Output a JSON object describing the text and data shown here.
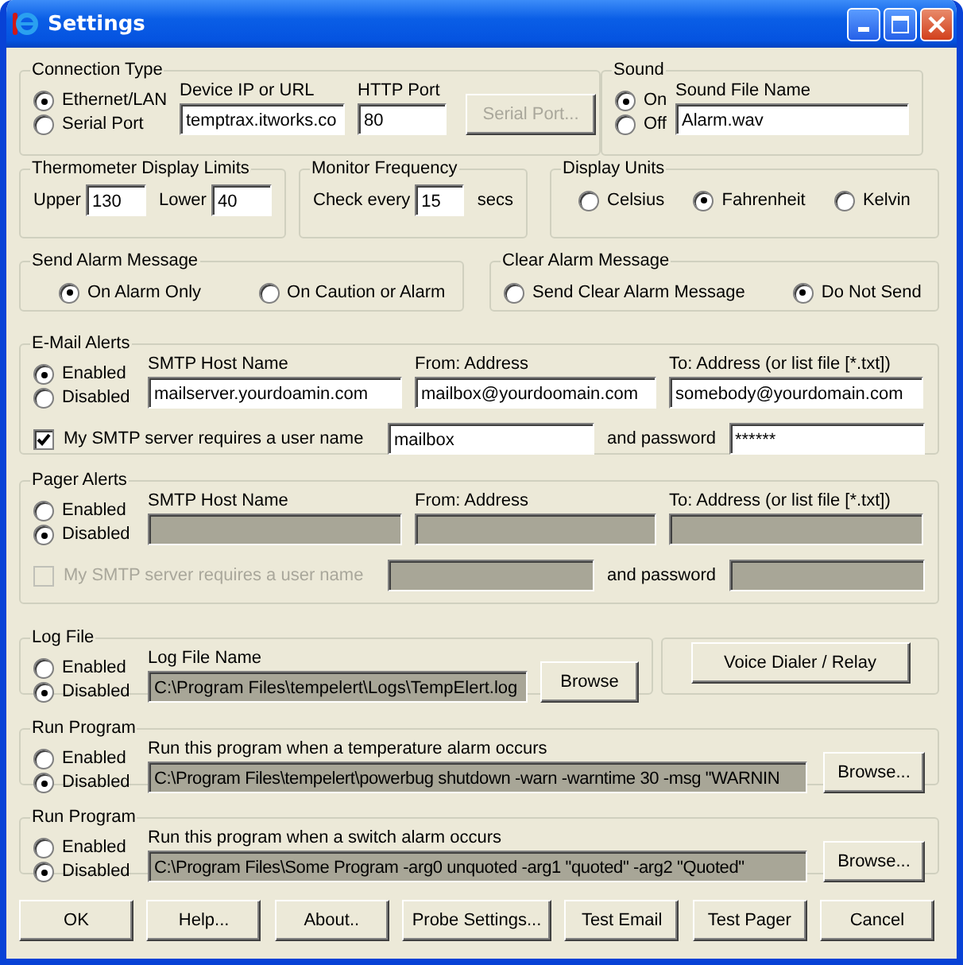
{
  "window": {
    "title": "Settings"
  },
  "connection": {
    "title": "Connection Type",
    "options": [
      {
        "label": "Ethernet/LAN",
        "selected": true
      },
      {
        "label": "Serial Port",
        "selected": false
      }
    ],
    "device_ip": {
      "label": "Device IP or URL",
      "value": "temptrax.itworks.co"
    },
    "http_port": {
      "label": "HTTP Port",
      "value": "80"
    },
    "serial_button": {
      "label": "Serial Port...",
      "disabled": true
    }
  },
  "sound": {
    "title": "Sound",
    "options": [
      {
        "label": "On",
        "selected": true
      },
      {
        "label": "Off",
        "selected": false
      }
    ],
    "file": {
      "label": "Sound File Name",
      "value": "Alarm.wav"
    }
  },
  "limits": {
    "title": "Thermometer Display Limits",
    "upper": {
      "label": "Upper",
      "value": "130"
    },
    "lower": {
      "label": "Lower",
      "value": "40"
    }
  },
  "monitor": {
    "title": "Monitor Frequency",
    "label": "Check every",
    "value": "15",
    "unit": "secs"
  },
  "units": {
    "title": "Display Units",
    "options": [
      {
        "label": "Celsius",
        "selected": false
      },
      {
        "label": "Fahrenheit",
        "selected": true
      },
      {
        "label": "Kelvin",
        "selected": false
      }
    ]
  },
  "send_alarm": {
    "title": "Send Alarm Message",
    "options": [
      {
        "label": "On Alarm Only",
        "selected": true
      },
      {
        "label": "On Caution or Alarm",
        "selected": false
      }
    ]
  },
  "clear_alarm": {
    "title": "Clear Alarm Message",
    "options": [
      {
        "label": "Send Clear Alarm Message",
        "selected": false
      },
      {
        "label": "Do Not Send",
        "selected": true
      }
    ]
  },
  "email": {
    "title": "E-Mail Alerts",
    "options": [
      {
        "label": "Enabled",
        "selected": true
      },
      {
        "label": "Disabled",
        "selected": false
      }
    ],
    "fields": [
      {
        "label": "SMTP Host Name",
        "value": "mailserver.yourdoamin.com"
      },
      {
        "label": "From: Address",
        "value": "mailbox@yourdoomain.com"
      },
      {
        "label": "To: Address (or list file [*.txt])",
        "value": "somebody@yourdomain.com"
      }
    ],
    "auth": {
      "label": "My SMTP server requires a user name",
      "checked": true,
      "username": "mailbox",
      "password_label": "and password",
      "password": "******"
    }
  },
  "pager": {
    "title": "Pager Alerts",
    "options": [
      {
        "label": "Enabled",
        "selected": false
      },
      {
        "label": "Disabled",
        "selected": true
      }
    ],
    "fields": [
      {
        "label": "SMTP Host Name"
      },
      {
        "label": "From: Address"
      },
      {
        "label": "To: Address (or list file [*.txt])"
      }
    ],
    "auth": {
      "label": "My SMTP server requires a user name",
      "checked": false,
      "password_label": "and password"
    }
  },
  "log_file": {
    "title": "Log File",
    "options": [
      {
        "label": "Enabled",
        "selected": false
      },
      {
        "label": "Disabled",
        "selected": true
      }
    ],
    "label": "Log File Name",
    "value": "C:\\Program Files\\tempelert\\Logs\\TempElert.log",
    "button": "Browse"
  },
  "voice_dialer": {
    "button": "Voice Dialer / Relay"
  },
  "run_programs": [
    {
      "title": "Run Program",
      "options": [
        {
          "label": "Enabled",
          "selected": false
        },
        {
          "label": "Disabled",
          "selected": true
        }
      ],
      "label": "Run this program when a temperature alarm occurs",
      "value": "C:\\Program Files\\tempelert\\powerbug shutdown -warn -warntime 30 -msg \"WARNIN",
      "button": "Browse..."
    },
    {
      "title": "Run Program",
      "options": [
        {
          "label": "Enabled",
          "selected": false
        },
        {
          "label": "Disabled",
          "selected": true
        }
      ],
      "label": "Run this program when a switch alarm occurs",
      "value": "C:\\Program Files\\Some Program -arg0 unquoted -arg1 \"quoted\" -arg2 \"Quoted\"",
      "button": "Browse..."
    }
  ],
  "buttons": [
    "OK",
    "Help...",
    "About..",
    "Probe Settings...",
    "Test Email",
    "Test Pager",
    "Cancel"
  ]
}
